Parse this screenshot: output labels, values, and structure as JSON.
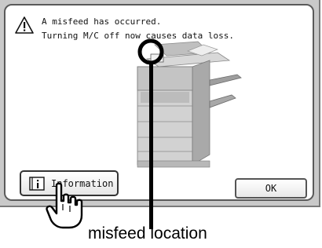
{
  "dialog": {
    "message_line1": "A misfeed has occurred.",
    "message_line2": "Turning M/C off now causes data loss.",
    "warning_icon": "warning-triangle-icon"
  },
  "buttons": {
    "information_label": "Information",
    "ok_label": "OK"
  },
  "annotation": {
    "callout_label": "misfeed location",
    "pointer_icon": "hand-pointer-icon"
  }
}
